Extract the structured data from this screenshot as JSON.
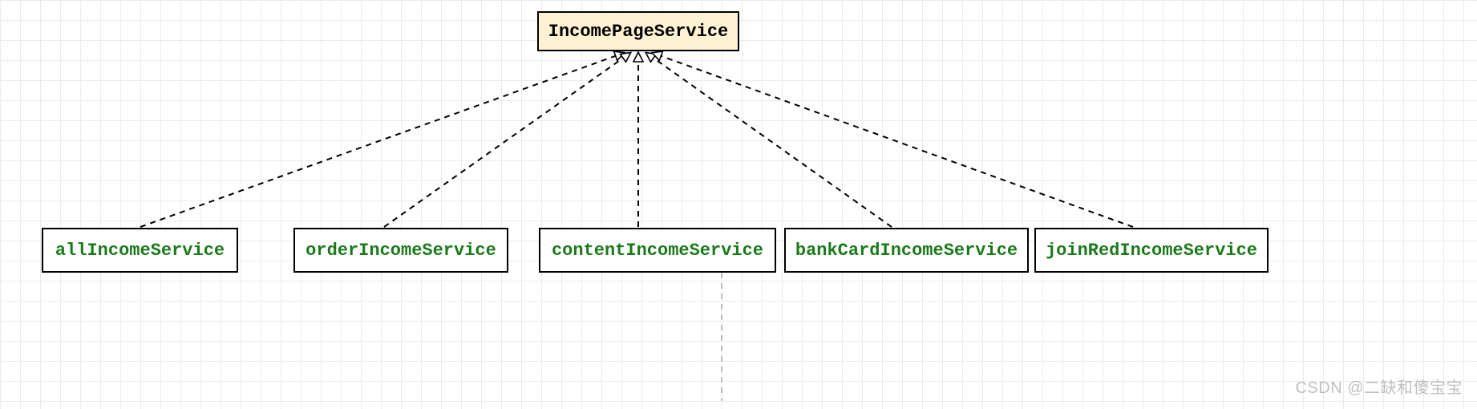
{
  "parent": {
    "label": "IncomePageService"
  },
  "children": [
    {
      "label": "allIncomeService"
    },
    {
      "label": "orderIncomeService"
    },
    {
      "label": "contentIncomeService"
    },
    {
      "label": "bankCardIncomeService"
    },
    {
      "label": "joinRedIncomeService"
    }
  ],
  "watermark": "CSDN @二缺和傻宝宝"
}
